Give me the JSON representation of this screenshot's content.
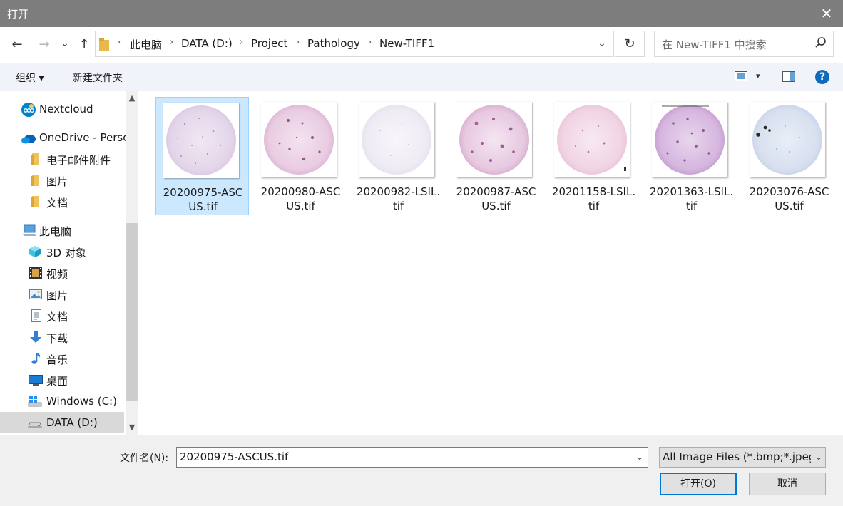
{
  "window": {
    "title": "打开",
    "close_glyph": "✕"
  },
  "nav": {
    "back_glyph": "←",
    "forward_glyph": "→",
    "recent_glyph": "⌄",
    "up_glyph": "↑",
    "breadcrumb": [
      "此电脑",
      "DATA (D:)",
      "Project",
      "Pathology",
      "New-TIFF1"
    ],
    "breadcrumb_sep": "›",
    "refresh_glyph": "↻",
    "dropdown_glyph": "⌄"
  },
  "search": {
    "placeholder": "在 New-TIFF1 中搜索"
  },
  "toolbar": {
    "organize_label": "组织 ▾",
    "new_folder_label": "新建文件夹",
    "view_arrow": "▾",
    "help_glyph": "?"
  },
  "sidebar": {
    "items": [
      {
        "label": "Nextcloud",
        "icon": "nextcloud-icon"
      },
      {
        "label": "OneDrive - Perso",
        "icon": "onedrive-icon"
      },
      {
        "label": "电子邮件附件",
        "icon": "folder-icon"
      },
      {
        "label": "图片",
        "icon": "folder-icon"
      },
      {
        "label": "文档",
        "icon": "folder-icon"
      },
      {
        "label": "此电脑",
        "icon": "computer-icon"
      },
      {
        "label": "3D 对象",
        "icon": "3d-objects-icon"
      },
      {
        "label": "视频",
        "icon": "video-icon"
      },
      {
        "label": "图片",
        "icon": "pictures-icon"
      },
      {
        "label": "文档",
        "icon": "documents-icon"
      },
      {
        "label": "下载",
        "icon": "download-icon"
      },
      {
        "label": "音乐",
        "icon": "music-icon"
      },
      {
        "label": "桌面",
        "icon": "desktop-icon"
      },
      {
        "label": "Windows (C:)",
        "icon": "windows-drive-icon"
      },
      {
        "label": "DATA (D:)",
        "icon": "drive-icon"
      }
    ],
    "scroll_up": "▲",
    "scroll_down": "▼"
  },
  "files": [
    {
      "line1": "20200975-ASC",
      "line2": "US.tif",
      "selected": true
    },
    {
      "line1": "20200980-ASC",
      "line2": "US.tif"
    },
    {
      "line1": "20200982-LSIL.",
      "line2": "tif"
    },
    {
      "line1": "20200987-ASC",
      "line2": "US.tif"
    },
    {
      "line1": "20201158-LSIL.",
      "line2": "tif"
    },
    {
      "line1": "20201363-LSIL.",
      "line2": "tif"
    },
    {
      "line1": "20203076-ASC",
      "line2": "US.tif"
    }
  ],
  "footer": {
    "filename_label": "文件名(N):",
    "filename_value": "20200975-ASCUS.tif",
    "filter_value": "All Image Files (*.bmp;*.jpeg",
    "open_label": "打开(O)",
    "cancel_label": "取消",
    "dropdown_glyph": "⌄"
  },
  "colors": {
    "accent": "#0078d7",
    "selection_bg": "#cce8ff",
    "titlebar": "#7d7d7d"
  }
}
